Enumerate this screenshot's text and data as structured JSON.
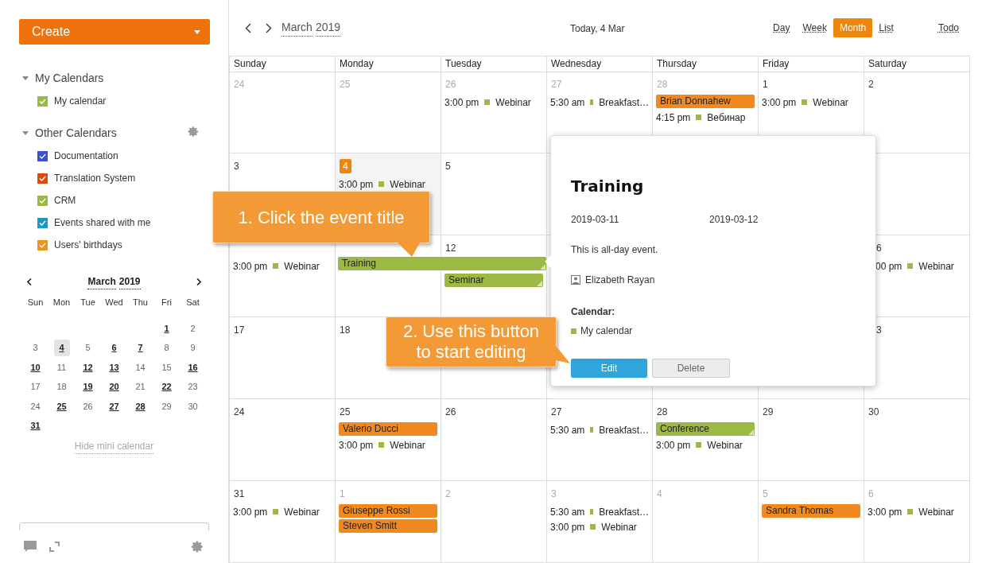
{
  "create_button": "Create",
  "my_calendars": {
    "title": "My Calendars",
    "expanded": true,
    "items": [
      {
        "label": "My calendar",
        "checked": true,
        "color": "#9bb944"
      }
    ]
  },
  "other_calendars": {
    "title": "Other Calendars",
    "expanded": true,
    "items": [
      {
        "label": "Documentation",
        "checked": true,
        "color": "#3b4fd8"
      },
      {
        "label": "Translation System",
        "checked": true,
        "color": "#e04a0e"
      },
      {
        "label": "CRM",
        "checked": true,
        "color": "#9bb944"
      },
      {
        "label": "Events shared with me",
        "checked": true,
        "color": "#1a9ac2"
      },
      {
        "label": "Users' birthdays",
        "checked": true,
        "color": "#f0921e"
      }
    ]
  },
  "mini_calendar": {
    "month": "March",
    "year": "2019",
    "weekdays": [
      "Sun",
      "Mon",
      "Tue",
      "Wed",
      "Thu",
      "Fri",
      "Sat"
    ],
    "weeks": [
      [
        {
          "day": "1",
          "bold": true,
          "selected": false
        },
        {
          "day": "2",
          "bold": false,
          "selected": false
        }
      ],
      [
        {
          "day": "3",
          "bold": false,
          "selected": false
        },
        {
          "day": "4",
          "bold": true,
          "selected": true
        },
        {
          "day": "5",
          "bold": false,
          "selected": false
        },
        {
          "day": "6",
          "bold": true,
          "selected": false
        },
        {
          "day": "7",
          "bold": true,
          "selected": false
        },
        {
          "day": "8",
          "bold": false,
          "selected": false
        },
        {
          "day": "9",
          "bold": false,
          "selected": false
        }
      ],
      [
        {
          "day": "10",
          "bold": true,
          "selected": false
        },
        {
          "day": "11",
          "bold": false,
          "selected": false
        },
        {
          "day": "12",
          "bold": true,
          "selected": false
        },
        {
          "day": "13",
          "bold": true,
          "selected": false
        },
        {
          "day": "14",
          "bold": false,
          "selected": false
        },
        {
          "day": "15",
          "bold": false,
          "selected": false
        },
        {
          "day": "16",
          "bold": true,
          "selected": false
        }
      ],
      [
        {
          "day": "17",
          "bold": false,
          "selected": false
        },
        {
          "day": "18",
          "bold": false,
          "selected": false
        },
        {
          "day": "19",
          "bold": true,
          "selected": false
        },
        {
          "day": "20",
          "bold": true,
          "selected": false
        },
        {
          "day": "21",
          "bold": false,
          "selected": false
        },
        {
          "day": "22",
          "bold": true,
          "selected": false
        },
        {
          "day": "23",
          "bold": false,
          "selected": false
        }
      ],
      [
        {
          "day": "24",
          "bold": false,
          "selected": false
        },
        {
          "day": "25",
          "bold": true,
          "selected": false
        },
        {
          "day": "26",
          "bold": false,
          "selected": false
        },
        {
          "day": "27",
          "bold": true,
          "selected": false
        },
        {
          "day": "28",
          "bold": true,
          "selected": false
        },
        {
          "day": "29",
          "bold": false,
          "selected": false
        },
        {
          "day": "30",
          "bold": false,
          "selected": false
        }
      ],
      [
        {
          "day": "31",
          "bold": true,
          "selected": false
        }
      ]
    ],
    "hide_link": "Hide mini calendar"
  },
  "toolbar": {
    "month": "March",
    "year": "2019",
    "today": "Today, 4 Mar",
    "views": [
      {
        "label": "Day",
        "selected": false
      },
      {
        "label": "Week",
        "selected": false
      },
      {
        "label": "Month",
        "selected": true
      },
      {
        "label": "List",
        "selected": false
      }
    ],
    "todo": "Todo"
  },
  "weekdays": [
    "Sunday",
    "Monday",
    "Tuesday",
    "Wednesday",
    "Thursday",
    "Friday",
    "Saturday"
  ],
  "weeks": [
    {
      "days": [
        {
          "date": "24",
          "muted": true
        },
        {
          "date": "25",
          "muted": true
        },
        {
          "date": "26",
          "muted": true,
          "events": [
            {
              "kind": "timed",
              "time": "3:00 pm",
              "title": "Webinar"
            }
          ]
        },
        {
          "date": "27",
          "muted": true,
          "events": [
            {
              "kind": "timed",
              "time": "5:30 am",
              "title": "Breakfast…"
            }
          ]
        },
        {
          "date": "28",
          "muted": true,
          "events": [
            {
              "kind": "birthday",
              "title": "Brian Donnahew",
              "color": "#f0891f"
            },
            {
              "kind": "timed",
              "time": "4:15 pm",
              "title": "Вебинар"
            }
          ]
        },
        {
          "date": "1",
          "muted": false,
          "events": [
            {
              "kind": "timed",
              "time": "3:00 pm",
              "title": "Webinar"
            }
          ]
        },
        {
          "date": "2",
          "muted": false
        }
      ]
    },
    {
      "days": [
        {
          "date": "3",
          "muted": false
        },
        {
          "date": "4",
          "today": true,
          "events": [
            {
              "kind": "timed",
              "time": "3:00 pm",
              "title": "Webinar"
            }
          ]
        },
        {
          "date": "5",
          "muted": false
        }
      ]
    },
    {
      "days": [
        {
          "events": [
            {
              "kind": "timed",
              "time": "3:00 pm",
              "title": "Webinar"
            }
          ]
        },
        {
          "events": [
            {
              "kind": "multiday",
              "title": "Training",
              "color": "#9bb944"
            }
          ]
        },
        {
          "date": "12",
          "muted": false,
          "below_multiday": true,
          "events": [
            {
              "kind": "allday",
              "title": "Seminar",
              "color": "#9bb944"
            }
          ]
        }
      ],
      "saturday": {
        "date": "6",
        "muted": false,
        "clipped": true,
        "events": [
          {
            "kind": "timed",
            "time": "00 pm",
            "title": "Webinar"
          }
        ]
      }
    },
    {
      "days": [
        {
          "date": "17",
          "muted": false
        },
        {
          "date": "18",
          "muted": false
        }
      ],
      "saturday": {
        "date": "3",
        "muted": false,
        "clipped": true
      }
    },
    {
      "days": [
        {
          "date": "24",
          "muted": false
        },
        {
          "date": "25",
          "muted": false,
          "events": [
            {
              "kind": "birthday",
              "title": "Valerio Ducci",
              "color": "#f0891f"
            },
            {
              "kind": "timed",
              "time": "3:00 pm",
              "title": "Webinar"
            }
          ]
        },
        {
          "date": "26",
          "muted": false
        },
        {
          "date": "27",
          "muted": false,
          "events": [
            {
              "kind": "timed",
              "time": "5:30 am",
              "title": "Breakfast…"
            }
          ]
        },
        {
          "date": "28",
          "muted": false,
          "events": [
            {
              "kind": "allday",
              "title": "Conference",
              "color": "#9bb944"
            },
            {
              "kind": "timed",
              "time": "3:00 pm",
              "title": "Webinar"
            }
          ]
        },
        {
          "date": "29",
          "muted": false
        },
        {
          "date": "30",
          "muted": false
        }
      ]
    },
    {
      "days": [
        {
          "date": "31",
          "muted": false,
          "events": [
            {
              "kind": "timed",
              "time": "3:00 pm",
              "title": "Webinar"
            }
          ]
        },
        {
          "date": "1",
          "muted": true,
          "events": [
            {
              "kind": "birthday",
              "title": "Giuseppe Rossi",
              "color": "#f0891f"
            },
            {
              "kind": "birthday",
              "title": "Steven Smitt",
              "color": "#f0891f"
            }
          ]
        },
        {
          "date": "2",
          "muted": true
        },
        {
          "date": "3",
          "muted": true,
          "events": [
            {
              "kind": "timed",
              "time": "5:30 am",
              "title": "Breakfast…"
            },
            {
              "kind": "timed",
              "time": "3:00 pm",
              "title": "Webinar"
            }
          ]
        },
        {
          "date": "4",
          "muted": true
        },
        {
          "date": "5",
          "muted": true,
          "events": [
            {
              "kind": "birthday",
              "title": "Sandra Thomas",
              "color": "#f0891f"
            }
          ]
        },
        {
          "date": "6",
          "muted": true,
          "events": [
            {
              "kind": "timed",
              "time": "3:00 pm",
              "title": "Webinar"
            }
          ]
        }
      ]
    }
  ],
  "popup": {
    "title": "Training",
    "start": "2019-03-11",
    "end": "2019-03-12",
    "description": "This is all-day event.",
    "organizer": "Elizabeth Rayan",
    "calendar_label": "Calendar:",
    "calendar": {
      "name": "My calendar",
      "color": "#9bb944"
    },
    "edit_button": "Edit",
    "delete_button": "Delete"
  },
  "callouts": [
    "1. Click the event title",
    "2. Use this button to start editing"
  ]
}
